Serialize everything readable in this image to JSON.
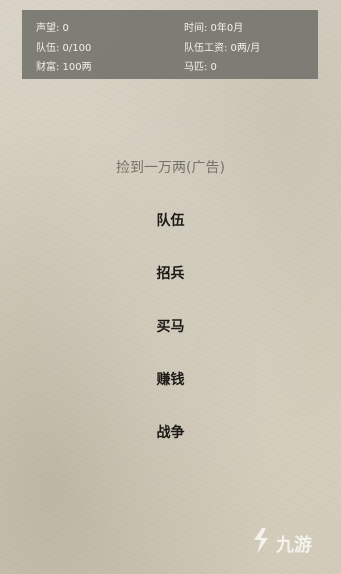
{
  "status": {
    "reputation": "声望: 0",
    "time": "时间: 0年0月",
    "troops": "队伍: 0/100",
    "troop_wage": "队伍工资: 0两/月",
    "wealth": "财富: 100两",
    "horses": "马匹: 0"
  },
  "menu": {
    "ad_label": "捡到一万两(广告)",
    "team_label": "队伍",
    "recruit_label": "招兵",
    "buy_horse_label": "买马",
    "earn_money_label": "赚钱",
    "war_label": "战争"
  },
  "watermark": {
    "text": "九游",
    "icon": "jiuyou-logo-icon"
  }
}
